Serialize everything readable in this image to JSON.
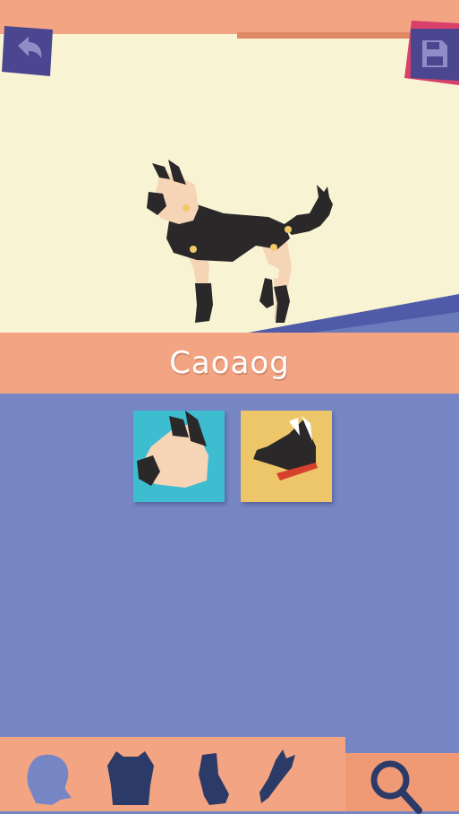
{
  "app": {
    "dog_name": "Caoaog"
  },
  "toolbar": {
    "categories": [
      "head",
      "body",
      "legs",
      "tail"
    ],
    "search": "search"
  },
  "icons": {
    "back": "back-arrow-icon",
    "save": "floppy-disk-icon",
    "search": "magnifier-icon"
  },
  "options": [
    {
      "name": "cream-dog-head",
      "background": "#3dbdcf",
      "selected": false
    },
    {
      "name": "black-dog-head-red-collar",
      "background": "#eec66a",
      "selected": false
    }
  ],
  "colors": {
    "scene": "#f8f4d3",
    "banner": "#f2a483",
    "panel": "#7686c4",
    "button": "#4a468f",
    "icon_dark": "#2b3a66"
  }
}
